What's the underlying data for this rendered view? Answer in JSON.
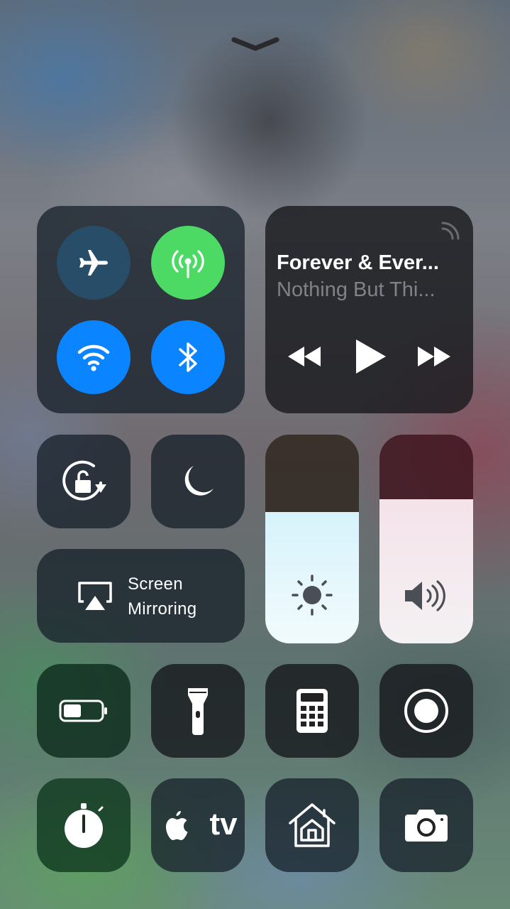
{
  "control_center": {
    "dismiss": {
      "icon": "chevron-down-icon"
    },
    "connectivity": {
      "airplane": {
        "icon": "airplane-icon",
        "state": "off",
        "color": "#1f4a6a"
      },
      "cellular": {
        "icon": "cellular-data-icon",
        "state": "on",
        "color": "#4cd964"
      },
      "wifi": {
        "icon": "wifi-icon",
        "state": "on",
        "color": "#0a84ff"
      },
      "bluetooth": {
        "icon": "bluetooth-icon",
        "state": "on",
        "color": "#0a84ff"
      }
    },
    "now_playing": {
      "title": "Forever & Ever...",
      "subtitle": "Nothing But Thi...",
      "icons": [
        "airplay-audio-icon",
        "rewind-icon",
        "play-icon",
        "fast-forward-icon"
      ]
    },
    "orientation_lock": {
      "icon": "rotation-lock-icon"
    },
    "do_not_disturb": {
      "icon": "moon-icon"
    },
    "screen_mirroring": {
      "line1": "Screen",
      "line2": "Mirroring",
      "icon": "airplay-screen-icon"
    },
    "brightness": {
      "level": 0.63,
      "icon": "sun-icon"
    },
    "volume": {
      "level": 0.69,
      "icon": "speaker-icon"
    },
    "shortcuts": [
      {
        "name": "low-power-mode",
        "icon": "battery-icon"
      },
      {
        "name": "flashlight",
        "icon": "flashlight-icon"
      },
      {
        "name": "calculator",
        "icon": "calculator-icon"
      },
      {
        "name": "screen-recording",
        "icon": "record-icon"
      },
      {
        "name": "timer",
        "icon": "timer-icon"
      },
      {
        "name": "apple-tv-remote",
        "label": "tv",
        "icon": "apple-tv-icon"
      },
      {
        "name": "home",
        "icon": "home-icon"
      },
      {
        "name": "camera",
        "icon": "camera-icon"
      }
    ],
    "colors": {
      "active_blue": "#0a84ff",
      "active_green": "#4cd964",
      "brightness_fill": "#e4f6fb",
      "volume_fill": "#f3e9ee"
    }
  }
}
